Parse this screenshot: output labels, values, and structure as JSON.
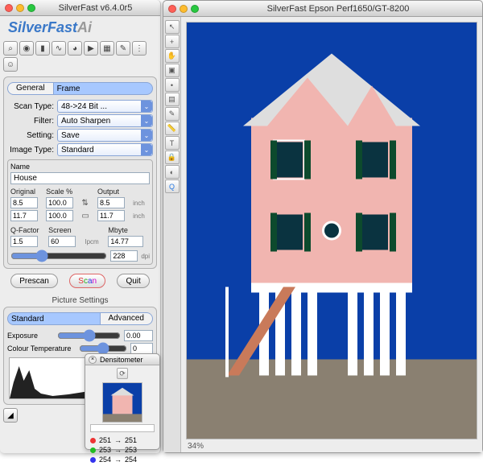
{
  "app": {
    "control_title": "SilverFast v6.4.0r5",
    "preview_title": "SilverFast Epson Perf1650/GT-8200",
    "brand_main": "SilverFast",
    "brand_suffix": "Ai"
  },
  "top_icons": [
    "loupe",
    "picker",
    "histogram",
    "curve",
    "color-wheel",
    "palette",
    "autocolor",
    "pencil",
    "expert",
    "person"
  ],
  "tabs_main": {
    "general": "General",
    "frame": "Frame",
    "selected": "frame"
  },
  "scan": {
    "type_label": "Scan Type:",
    "type_value": "48->24 Bit ...",
    "filter_label": "Filter:",
    "filter_value": "Auto Sharpen",
    "setting_label": "Setting:",
    "setting_value": "Save",
    "image_type_label": "Image Type:",
    "image_type_value": "Standard"
  },
  "name_label": "Name",
  "name_value": "House",
  "dims": {
    "hdr": [
      "Original",
      "Scale %",
      "",
      "Output",
      ""
    ],
    "w_orig": "8.5",
    "w_scale": "100.0",
    "w_out": "8.5",
    "w_unit": "inch",
    "h_orig": "11.7",
    "h_scale": "100.0",
    "h_out": "11.7",
    "h_unit": "inch",
    "q_label": "Q-Factor",
    "screen_label": "Screen",
    "mbyte_label": "Mbyte",
    "q_value": "1.5",
    "screen_value": "60",
    "screen_unit": "lpcm",
    "mbyte_value": "14.77",
    "dpi_value": "228",
    "dpi_unit": "dpi"
  },
  "buttons": {
    "prescan": "Prescan",
    "scan": "Scan",
    "quit": "Quit"
  },
  "picture": {
    "title": "Picture Settings",
    "tab_standard": "Standard",
    "tab_advanced": "Advanced",
    "selected": "standard",
    "exposure_label": "Exposure",
    "exposure_value": "0.00",
    "ct_label": "Colour Temperature",
    "ct_value": "0"
  },
  "densitometer": {
    "title": "Densitometer",
    "r": "251",
    "r2": "251",
    "g": "253",
    "g2": "253",
    "b": "254",
    "b2": "254"
  },
  "vertical_tools": [
    "arrow",
    "plus",
    "hand",
    "crop",
    "pointer",
    "layers",
    "eyedrop",
    "ruler",
    "text",
    "lock",
    "mask",
    "zoom"
  ],
  "status": {
    "zoom": "34%"
  }
}
